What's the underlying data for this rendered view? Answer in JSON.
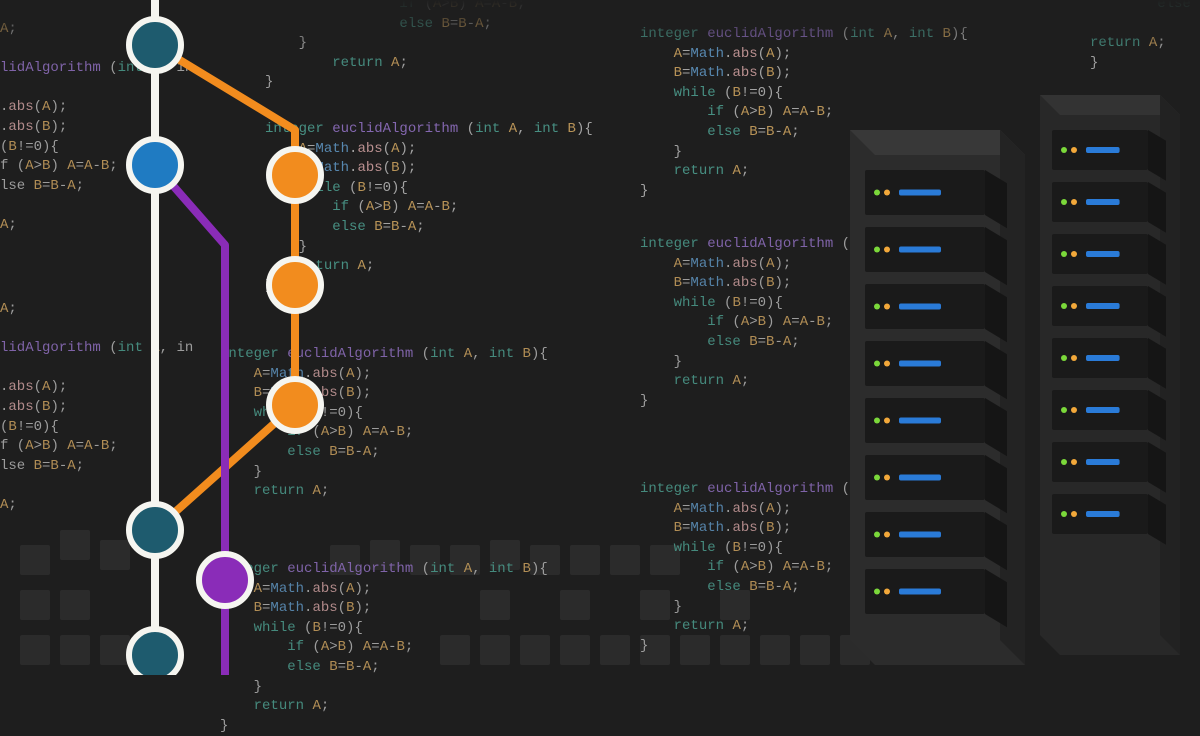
{
  "colors": {
    "bg": "#1e1e1e",
    "teal": "#1e5b6e",
    "blue": "#1f7bc2",
    "orange": "#f28c1e",
    "purple": "#8a2cb8",
    "white": "#f5f5f0"
  },
  "code_lines": {
    "sig": "integer euclidAlgorithm (int A, int B){",
    "abs_a": "    A=Math.abs(A);",
    "abs_b": "    B=Math.abs(B);",
    "while": "    while (B!=0){",
    "if": "        if (A>B) A=A-B;",
    "else": "        else B=B-A;",
    "close1": "    }",
    "return": "    return A;",
    "close2": "}"
  },
  "partial_lines": {
    "a_semi": "A;",
    "lid": "lidAlgorithm (int A, in",
    "abs_a": ".abs(A);",
    "abs_b": ".abs(B);",
    "bneq": "(B!=0){",
    "if_p": "f (A>B) A=A-B;",
    "lse": "lse B=B-A;",
    "sig_partial_right": "integer euclidAlgori",
    "return_a": "return A;"
  }
}
